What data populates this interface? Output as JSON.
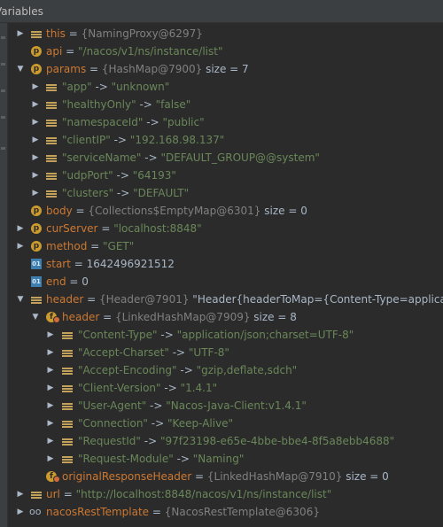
{
  "panel": {
    "title": "Variables"
  },
  "rows": [
    {
      "name": "this",
      "sep": " = ",
      "value": "{NamingProxy@6297}",
      "value_kind": "obj",
      "extra": ""
    },
    {
      "name": "api",
      "sep": " = ",
      "value": "\"/nacos/v1/ns/instance/list\"",
      "value_kind": "val",
      "extra": ""
    },
    {
      "name": "params",
      "sep": " = ",
      "value": "{HashMap@7900}",
      "value_kind": "obj",
      "extra": "  size = 7"
    },
    {
      "name": "\"app\"",
      "sep": " -> ",
      "value": "\"unknown\"",
      "value_kind": "val",
      "extra": ""
    },
    {
      "name": "\"healthyOnly\"",
      "sep": " -> ",
      "value": "\"false\"",
      "value_kind": "val",
      "extra": ""
    },
    {
      "name": "\"namespaceId\"",
      "sep": " -> ",
      "value": "\"public\"",
      "value_kind": "val",
      "extra": ""
    },
    {
      "name": "\"clientIP\"",
      "sep": " -> ",
      "value": "\"192.168.98.137\"",
      "value_kind": "val",
      "extra": ""
    },
    {
      "name": "\"serviceName\"",
      "sep": " -> ",
      "value": "\"DEFAULT_GROUP@@system\"",
      "value_kind": "val",
      "extra": ""
    },
    {
      "name": "\"udpPort\"",
      "sep": " -> ",
      "value": "\"64193\"",
      "value_kind": "val",
      "extra": ""
    },
    {
      "name": "\"clusters\"",
      "sep": " -> ",
      "value": "\"DEFAULT\"",
      "value_kind": "val",
      "extra": ""
    },
    {
      "name": "body",
      "sep": " = ",
      "value": "{Collections$EmptyMap@6301}",
      "value_kind": "obj",
      "extra": "  size = 0"
    },
    {
      "name": "curServer",
      "sep": " = ",
      "value": "\"localhost:8848\"",
      "value_kind": "val",
      "extra": ""
    },
    {
      "name": "method",
      "sep": " = ",
      "value": "\"GET\"",
      "value_kind": "val",
      "extra": ""
    },
    {
      "name": "start",
      "sep": " = ",
      "value": "1642496921512",
      "value_kind": "plain",
      "extra": ""
    },
    {
      "name": "end",
      "sep": " = ",
      "value": "0",
      "value_kind": "plain",
      "extra": ""
    },
    {
      "name": "header",
      "sep": " = ",
      "value": "{Header@7901}",
      "value_kind": "obj",
      "extra": " \"Header{headerToMap={Content-Type=application"
    },
    {
      "name": "header",
      "sep": " = ",
      "value": "{LinkedHashMap@7909}",
      "value_kind": "obj",
      "extra": "  size = 8"
    },
    {
      "name": "\"Content-Type\"",
      "sep": " -> ",
      "value": "\"application/json;charset=UTF-8\"",
      "value_kind": "val",
      "extra": ""
    },
    {
      "name": "\"Accept-Charset\"",
      "sep": " -> ",
      "value": "\"UTF-8\"",
      "value_kind": "val",
      "extra": ""
    },
    {
      "name": "\"Accept-Encoding\"",
      "sep": " -> ",
      "value": "\"gzip,deflate,sdch\"",
      "value_kind": "val",
      "extra": ""
    },
    {
      "name": "\"Client-Version\"",
      "sep": " -> ",
      "value": "\"1.4.1\"",
      "value_kind": "val",
      "extra": ""
    },
    {
      "name": "\"User-Agent\"",
      "sep": " -> ",
      "value": "\"Nacos-Java-Client:v1.4.1\"",
      "value_kind": "val",
      "extra": ""
    },
    {
      "name": "\"Connection\"",
      "sep": " -> ",
      "value": "\"Keep-Alive\"",
      "value_kind": "val",
      "extra": ""
    },
    {
      "name": "\"RequestId\"",
      "sep": " -> ",
      "value": "\"97f23198-e65e-4bbe-bbe4-8f5a8ebb4688\"",
      "value_kind": "val",
      "extra": ""
    },
    {
      "name": "\"Request-Module\"",
      "sep": " -> ",
      "value": "\"Naming\"",
      "value_kind": "val",
      "extra": ""
    },
    {
      "name": "originalResponseHeader",
      "sep": " = ",
      "value": "{LinkedHashMap@7910}",
      "value_kind": "obj",
      "extra": "  size = 0"
    },
    {
      "name": "url",
      "sep": " = ",
      "value": "\"http://localhost:8848/nacos/v1/ns/instance/list\"",
      "value_kind": "val",
      "extra": ""
    },
    {
      "name": "nacosRestTemplate",
      "sep": " = ",
      "value": "{NacosRestTemplate@6306}",
      "value_kind": "obj",
      "extra": ""
    }
  ]
}
